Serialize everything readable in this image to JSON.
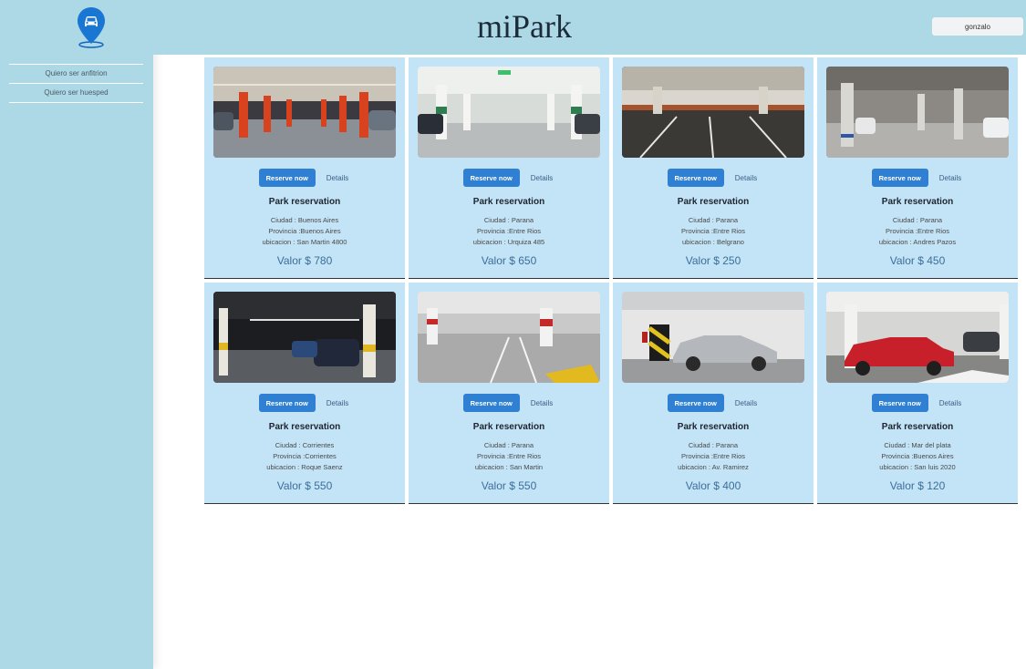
{
  "app": {
    "title": "miPark"
  },
  "header": {
    "user_label": "gonzalo"
  },
  "sidebar": {
    "logo_icon": "parking-pin-car-icon",
    "links": [
      "Quiero ser anfitrion",
      "Quiero ser huesped"
    ]
  },
  "card_labels": {
    "reserve": "Reserve now",
    "details": "Details",
    "title": "Park reservation"
  },
  "cards": [
    {
      "ciudad": "Ciudad : Buenos Aires",
      "provincia": "Provincia :Buenos Aires",
      "ubicacion": "ubicacion : San Martin 4800",
      "valor": "Valor $ 780"
    },
    {
      "ciudad": "Ciudad : Parana",
      "provincia": "Provincia :Entre Rios",
      "ubicacion": "ubicacion : Urquiza 485",
      "valor": "Valor $ 650"
    },
    {
      "ciudad": "Ciudad : Parana",
      "provincia": "Provincia :Entre Rios",
      "ubicacion": "ubicacion : Belgrano",
      "valor": "Valor $ 250"
    },
    {
      "ciudad": "Ciudad : Parana",
      "provincia": "Provincia :Entre Rios",
      "ubicacion": "ubicacion : Andres Pazos",
      "valor": "Valor $ 450"
    },
    {
      "ciudad": "Ciudad : Corrientes",
      "provincia": "Provincia :Corrientes",
      "ubicacion": "ubicacion : Roque Saenz",
      "valor": "Valor $ 550"
    },
    {
      "ciudad": "Ciudad : Parana",
      "provincia": "Provincia :Entre Rios",
      "ubicacion": "ubicacion : San Martin",
      "valor": "Valor $ 550"
    },
    {
      "ciudad": "Ciudad : Parana",
      "provincia": "Provincia :Entre Rios",
      "ubicacion": "ubicacion : Av. Ramirez",
      "valor": "Valor $ 400"
    },
    {
      "ciudad": "Ciudad : Mar del plata",
      "provincia": "Provincia :Buenos Aires",
      "ubicacion": "ubicacion : San luis 2020",
      "valor": "Valor $ 120"
    }
  ],
  "colors": {
    "sidebar_bg": "#add8e6",
    "card_bg": "#c3e3f6",
    "primary_button": "#2f7fd2",
    "price_text": "#3c6e9a"
  }
}
